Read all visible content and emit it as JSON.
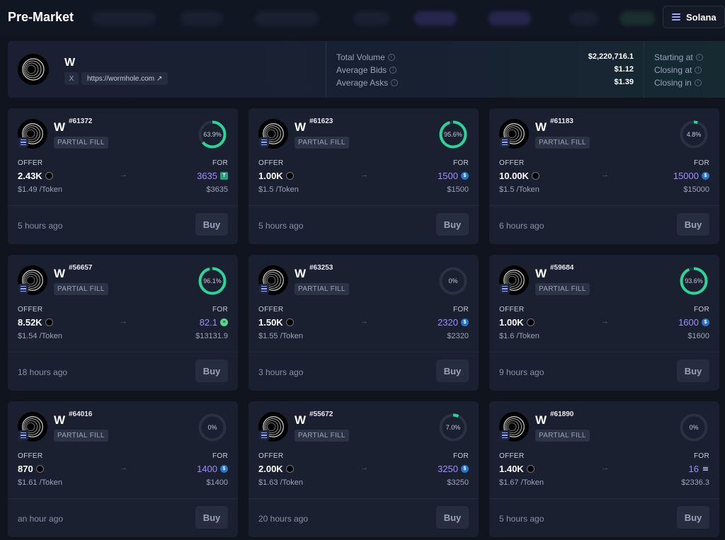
{
  "page": {
    "title": "Pre-Market"
  },
  "chain_selector": {
    "label": "Solana",
    "icon": "solana-icon"
  },
  "token": {
    "symbol": "W",
    "social_icon": "x-icon",
    "social_label": "X",
    "website": "https://wormhole.com",
    "link_icon": "external-link-icon"
  },
  "stats": {
    "total_volume_label": "Total Volume",
    "total_volume": "$2,220,716.1",
    "average_bids_label": "Average Bids",
    "average_bids": "$1.12",
    "average_asks_label": "Average Asks",
    "average_asks": "$1.39",
    "starting_at_label": "Starting at",
    "closing_at_label": "Closing at",
    "closing_in_label": "Closing in"
  },
  "labels": {
    "offer": "OFFER",
    "for": "FOR",
    "buy": "Buy",
    "partial_fill": "PARTIAL FILL",
    "arrow": "→"
  },
  "colors": {
    "accent_green": "#2bd597",
    "accent_purple": "#9f8cff",
    "ring_track": "#2a3142"
  },
  "orders": [
    {
      "symbol": "W",
      "id": "#61372",
      "badge": "PARTIAL FILL",
      "fill_pct": 63.9,
      "fill_label": "63.9%",
      "offer_amount": "2.43K",
      "for_amount": "3635",
      "for_token": "usdt",
      "per_token": "$1.49 /Token",
      "for_usd": "$3635",
      "time": "5 hours ago"
    },
    {
      "symbol": "W",
      "id": "#61623",
      "badge": "PARTIAL FILL",
      "fill_pct": 95.6,
      "fill_label": "95.6%",
      "offer_amount": "1.00K",
      "for_amount": "1500",
      "for_token": "usdc",
      "per_token": "$1.5 /Token",
      "for_usd": "$1500",
      "time": "5 hours ago"
    },
    {
      "symbol": "W",
      "id": "#61183",
      "badge": "PARTIAL FILL",
      "fill_pct": 4.8,
      "fill_label": "4.8%",
      "offer_amount": "10.00K",
      "for_amount": "15000",
      "for_token": "usdc",
      "per_token": "$1.5 /Token",
      "for_usd": "$15000",
      "time": "6 hours ago"
    },
    {
      "symbol": "W",
      "id": "#56657",
      "badge": "PARTIAL FILL",
      "fill_pct": 96.1,
      "fill_label": "96.1%",
      "offer_amount": "8.52K",
      "for_amount": "82.1",
      "for_token": "sol-green",
      "per_token": "$1.54 /Token",
      "for_usd": "$13131.9",
      "time": "18 hours ago"
    },
    {
      "symbol": "W",
      "id": "#63253",
      "badge": "PARTIAL FILL",
      "fill_pct": 0,
      "fill_label": "0%",
      "offer_amount": "1.50K",
      "for_amount": "2320",
      "for_token": "usdc",
      "per_token": "$1.55 /Token",
      "for_usd": "$2320",
      "time": "3 hours ago"
    },
    {
      "symbol": "W",
      "id": "#59684",
      "badge": "PARTIAL FILL",
      "fill_pct": 93.6,
      "fill_label": "93.6%",
      "offer_amount": "1.00K",
      "for_amount": "1600",
      "for_token": "usdc",
      "per_token": "$1.6 /Token",
      "for_usd": "$1600",
      "time": "9 hours ago"
    },
    {
      "symbol": "W",
      "id": "#64016",
      "badge": "PARTIAL FILL",
      "fill_pct": 0,
      "fill_label": "0%",
      "offer_amount": "870",
      "for_amount": "1400",
      "for_token": "usdc",
      "per_token": "$1.61 /Token",
      "for_usd": "$1400",
      "time": "an hour ago"
    },
    {
      "symbol": "W",
      "id": "#55672",
      "badge": "PARTIAL FILL",
      "fill_pct": 7.0,
      "fill_label": "7.0%",
      "offer_amount": "2.00K",
      "for_amount": "3250",
      "for_token": "usdc",
      "per_token": "$1.63 /Token",
      "for_usd": "$3250",
      "time": "20 hours ago"
    },
    {
      "symbol": "W",
      "id": "#61890",
      "badge": "PARTIAL FILL",
      "fill_pct": 0,
      "fill_label": "0%",
      "offer_amount": "1.40K",
      "for_amount": "16",
      "for_token": "sol",
      "per_token": "$1.67 /Token",
      "for_usd": "$2336.3",
      "time": "5 hours ago"
    }
  ]
}
